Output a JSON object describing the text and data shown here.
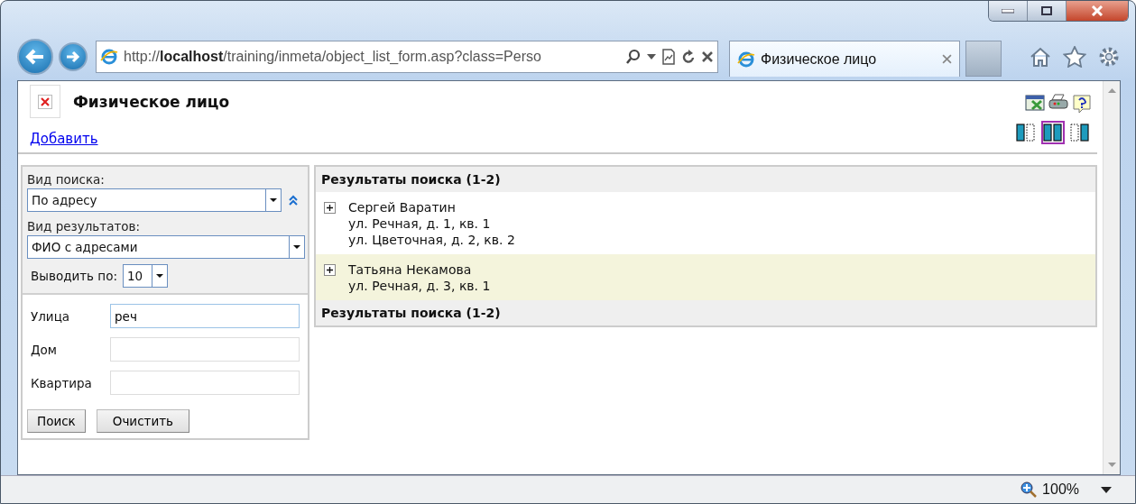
{
  "browser": {
    "address": "http://**localhost**/training/inmeta/object_list_form.asp?class=Perso",
    "tabs": [
      {
        "title": "Физическое лицо",
        "selected": true
      }
    ],
    "zoom": "100%"
  },
  "page": {
    "title": "Физическое лицо",
    "add_link": "Добавить",
    "layout_buttons": [
      {
        "kind": "left",
        "selected": false
      },
      {
        "kind": "both",
        "selected": true
      },
      {
        "kind": "right",
        "selected": false
      }
    ]
  },
  "search": {
    "search_type_label": "Вид поиска:",
    "search_type": "По адресу",
    "result_type_label": "Вид результатов:",
    "result_type": "ФИО с адресами",
    "page_size_label": "Выводить по:",
    "page_size": "10",
    "fields": [
      {
        "label": "Улица",
        "value": "реч",
        "focused": true
      },
      {
        "label": "Дом",
        "focused": false
      },
      {
        "label": "Квартира",
        "focused": false
      }
    ],
    "buttons": [
      "Поиск",
      "Очистить"
    ]
  },
  "results": {
    "header": "Результаты поиска (1-2)",
    "rows": [
      {
        "name": "Сергей Варатин",
        "addresses": [
          "ул. Речная, д. 1, кв. 1",
          "ул. Цветочная, д. 2, кв. 2"
        ],
        "highlighted": false
      },
      {
        "name": "Татьяна Некамова",
        "addresses": [
          "ул. Речная, д. 3, кв. 1"
        ],
        "highlighted": true
      }
    ],
    "footer": "Результаты поиска (1-2)"
  }
}
